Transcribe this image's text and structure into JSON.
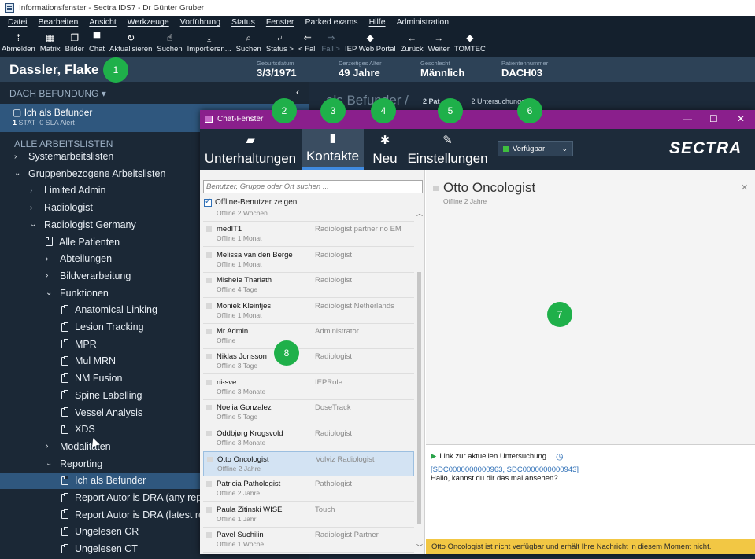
{
  "window": {
    "title": "Informationsfenster - Sectra IDS7 - Dr Günter Gruber"
  },
  "menu": [
    "Datei",
    "Bearbeiten",
    "Ansicht",
    "Werkzeuge",
    "Vorführung",
    "Status",
    "Fenster",
    "Parked exams",
    "Hilfe",
    "Administration"
  ],
  "toolbar": [
    {
      "label": "Abmelden",
      "icon": "logout-icon",
      "glyph": "⇡"
    },
    {
      "label": "Matrix",
      "icon": "matrix-icon",
      "glyph": "▦"
    },
    {
      "label": "Bilder",
      "icon": "images-icon",
      "glyph": "❐"
    },
    {
      "label": "Chat",
      "icon": "chat-icon",
      "glyph": "▀"
    },
    {
      "label": "Aktualisieren",
      "icon": "refresh-icon",
      "glyph": "↻"
    },
    {
      "label": "Suchen",
      "icon": "search-pointer-icon",
      "glyph": "☝"
    },
    {
      "label": "Importieren...",
      "icon": "import-icon",
      "glyph": "⤓"
    },
    {
      "label": "Suchen",
      "icon": "search-icon",
      "glyph": "⌕"
    },
    {
      "label": "Status >",
      "icon": "status-icon",
      "glyph": "⤶"
    },
    {
      "label": "< Fall",
      "icon": "prev-case-icon",
      "glyph": "⇐"
    },
    {
      "label": "Fall >",
      "icon": "next-case-icon",
      "glyph": "⇒"
    },
    {
      "label": "IEP Web Portal",
      "icon": "diamond-icon",
      "glyph": "◆"
    },
    {
      "label": "Zurück",
      "icon": "back-icon",
      "glyph": "←"
    },
    {
      "label": "Weiter",
      "icon": "forward-icon",
      "glyph": "→"
    },
    {
      "label": "TOMTEC",
      "icon": "diamond-icon",
      "glyph": "◆"
    }
  ],
  "patient": {
    "name": "Dassler, Flake",
    "fields": [
      {
        "label": "Geburtsdatum",
        "value": "3/3/1971"
      },
      {
        "label": "Derzeitiges Alter",
        "value": "49 Jahre"
      },
      {
        "label": "Geschlecht",
        "value": "Männlich"
      },
      {
        "label": "Patientennummer",
        "value": "DACH03"
      }
    ]
  },
  "sidebar": {
    "dropdown": "DACH BEFUNDUNG",
    "active_worklist": {
      "title": "Ich als Befunder",
      "stat_count": "1",
      "stat_label": "STAT",
      "sla_count": "0",
      "sla_label": "SLA Alert"
    },
    "section": "ALLE ARBEITSLISTEN",
    "tree": [
      {
        "label": "Systemarbeitslisten",
        "kind": "closed"
      },
      {
        "label": "Gruppenbezogene Arbeitslisten",
        "kind": "open"
      },
      {
        "label": "Limited Admin",
        "kind": "closed-dim"
      },
      {
        "label": "Radiologist",
        "kind": "closed"
      },
      {
        "label": "Radiologist Germany",
        "kind": "open"
      },
      {
        "label": "Alle Patienten",
        "kind": "doc"
      },
      {
        "label": "Abteilungen",
        "kind": "closed"
      },
      {
        "label": "Bildverarbeitung",
        "kind": "closed"
      },
      {
        "label": "Funktionen",
        "kind": "open"
      },
      {
        "label": "Anatomical Linking",
        "kind": "doc"
      },
      {
        "label": "Lesion Tracking",
        "kind": "doc"
      },
      {
        "label": "MPR",
        "kind": "doc"
      },
      {
        "label": "Mul MRN",
        "kind": "doc"
      },
      {
        "label": "NM Fusion",
        "kind": "doc"
      },
      {
        "label": "Spine Labelling",
        "kind": "doc"
      },
      {
        "label": "Vessel Analysis",
        "kind": "doc"
      },
      {
        "label": "XDS",
        "kind": "doc"
      },
      {
        "label": "Modalitäten",
        "kind": "closed"
      },
      {
        "label": "Reporting",
        "kind": "open"
      },
      {
        "label": "Ich als Befunder",
        "kind": "doc"
      },
      {
        "label": "Report Autor is DRA (any repor",
        "kind": "doc"
      },
      {
        "label": "Report Autor is DRA (latest rep",
        "kind": "doc"
      },
      {
        "label": "Ungelesen CR",
        "kind": "doc"
      },
      {
        "label": "Ungelesen CT",
        "kind": "doc"
      }
    ]
  },
  "main_header": {
    "title": "als Befunder /",
    "count_text": "2 Pat",
    "count_text2": "2 Untersuchungen"
  },
  "chat": {
    "title": "Chat-Fenster",
    "tabs": [
      {
        "label": "Unterhaltungen",
        "icon": "conversations-icon",
        "glyph": "▰"
      },
      {
        "label": "Kontakte",
        "icon": "contacts-icon",
        "glyph": "▮"
      },
      {
        "label": "Neu",
        "icon": "new-chat-icon",
        "glyph": "✱"
      },
      {
        "label": "Einstellungen",
        "icon": "settings-icon",
        "glyph": "✎"
      }
    ],
    "status": "Verfügbar",
    "brand": "SECTRA",
    "search_placeholder": "Benutzer, Gruppe oder Ort suchen ...",
    "show_offline": "Offline-Benutzer zeigen",
    "contacts": [
      {
        "name": "",
        "status": "Offline 2 Wochen",
        "role": ""
      },
      {
        "name": "medIT1",
        "status": "Offline 1 Monat",
        "role": "Radiologist partner no EM"
      },
      {
        "name": "Melissa van den Berge",
        "status": "Offline 1 Monat",
        "role": "Radiologist"
      },
      {
        "name": "Mishele Thariath",
        "status": "Offline 4 Tage",
        "role": "Radiologist"
      },
      {
        "name": "Moniek Kleintjes",
        "status": "Offline 1 Monat",
        "role": "Radiologist Netherlands"
      },
      {
        "name": "Mr Admin",
        "status": "Offline",
        "role": "Administrator"
      },
      {
        "name": "Niklas Jonsson",
        "status": "Offline 3 Tage",
        "role": "Radiologist"
      },
      {
        "name": "ni-sve",
        "status": "Offline 3 Monate",
        "role": "IEPRole"
      },
      {
        "name": "Noelia Gonzalez",
        "status": "Offline 5 Tage",
        "role": "DoseTrack"
      },
      {
        "name": "Oddbjørg Krogsvold",
        "status": "Offline 3 Monate",
        "role": "Radiologist"
      },
      {
        "name": "Otto Oncologist",
        "status": "Offline 2 Jahre",
        "role": "Volviz Radiologist"
      },
      {
        "name": "Patricia Pathologist",
        "status": "Offline 2 Jahre",
        "role": "Pathologist"
      },
      {
        "name": "Paula Zitinski WISE",
        "status": "Offline 1 Jahr",
        "role": "Touch"
      },
      {
        "name": "Pavel Suchilin",
        "status": "Offline 1 Woche",
        "role": "Radiologist Partner"
      }
    ],
    "conversation": {
      "name": "Otto Oncologist",
      "status": "Offline 2 Jahre",
      "link_label": "Link zur aktuellen Untersuchung",
      "link_ids": "[SDC0000000000963, SDC0000000000943]",
      "message": "Hallo, kannst du dir das mal ansehen?",
      "warning": "Otto Oncologist ist nicht verfügbar und erhält Ihre Nachricht in diesem Moment nicht."
    }
  },
  "callouts": [
    "1",
    "2",
    "3",
    "4",
    "5",
    "6",
    "7",
    "8"
  ],
  "colors": {
    "accent": "#1fb04a",
    "chat_title": "#8a1f8c",
    "warning": "#f2c744",
    "selected": "#2f577e"
  }
}
